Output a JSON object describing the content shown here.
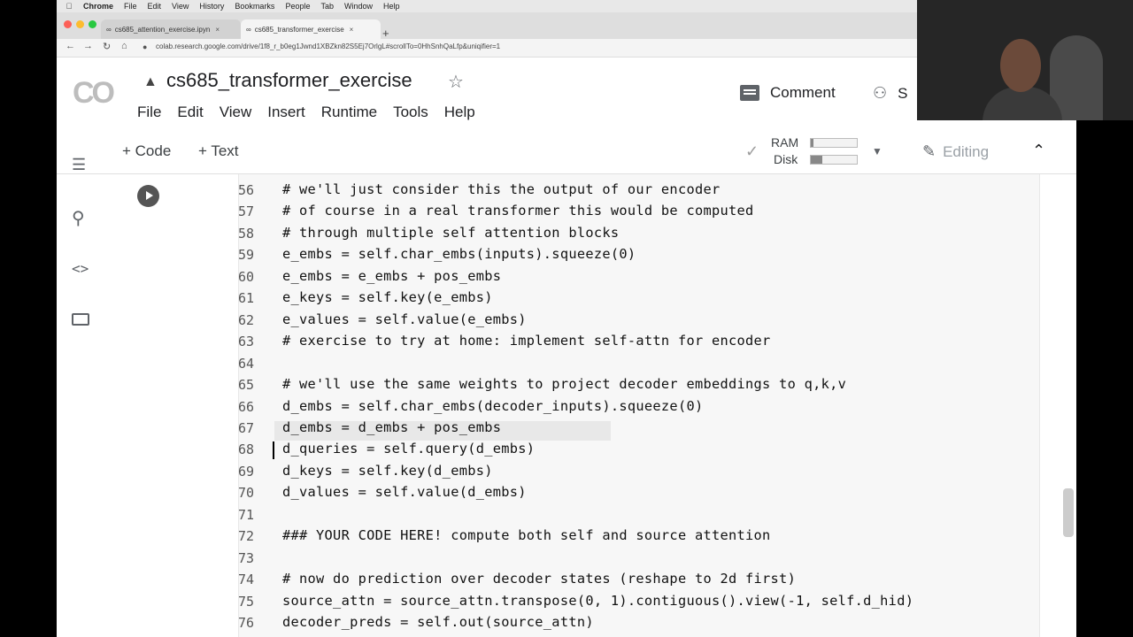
{
  "mac_menu": {
    "app": "Chrome",
    "items": [
      "File",
      "Edit",
      "View",
      "History",
      "Bookmarks",
      "People",
      "Tab",
      "Window",
      "Help"
    ]
  },
  "browser": {
    "tabs": [
      {
        "label": "cs685_attention_exercise.ipyn",
        "active": false
      },
      {
        "label": "cs685_transformer_exercise",
        "active": true
      }
    ],
    "url": "colab.research.google.com/drive/1f8_r_b0eg1Jwnd1XBZkn82S5Ej7OrlgL#scrollTo=0HhSnhQaLfp&uniqifier=1"
  },
  "colab": {
    "logo": "CO",
    "title": "cs685_transformer_exercise",
    "menu": [
      "File",
      "Edit",
      "View",
      "Insert",
      "Runtime",
      "Tools",
      "Help"
    ],
    "comment_label": "Comment",
    "share_label": "S",
    "add_code": "+ Code",
    "add_text": "+ Text",
    "ram_label": "RAM",
    "disk_label": "Disk",
    "ram_usage": 0.05,
    "disk_usage": 0.25,
    "editing_label": "Editing"
  },
  "code_lines": [
    {
      "n": "56",
      "text": "# we'll just consider this the output of our encoder"
    },
    {
      "n": "57",
      "text": "# of course in a real transformer this would be computed"
    },
    {
      "n": "58",
      "text": "# through multiple self attention blocks"
    },
    {
      "n": "59",
      "text": "e_embs = self.char_embs(inputs).squeeze(0)"
    },
    {
      "n": "60",
      "text": "e_embs = e_embs + pos_embs"
    },
    {
      "n": "61",
      "text": "e_keys = self.key(e_embs)"
    },
    {
      "n": "62",
      "text": "e_values = self.value(e_embs)"
    },
    {
      "n": "63",
      "text": "# exercise to try at home: implement self-attn for encoder"
    },
    {
      "n": "64",
      "text": ""
    },
    {
      "n": "65",
      "text": "# we'll use the same weights to project decoder embeddings to q,k,v"
    },
    {
      "n": "66",
      "text": "d_embs = self.char_embs(decoder_inputs).squeeze(0)"
    },
    {
      "n": "67",
      "text": "d_embs = d_embs + pos_embs"
    },
    {
      "n": "68",
      "text": "d_queries = self.query(d_embs)"
    },
    {
      "n": "69",
      "text": "d_keys = self.key(d_embs)"
    },
    {
      "n": "70",
      "text": "d_values = self.value(d_embs)"
    },
    {
      "n": "71",
      "text": ""
    },
    {
      "n": "72",
      "text": "### YOUR CODE HERE! compute both self and source attention"
    },
    {
      "n": "73",
      "text": ""
    },
    {
      "n": "74",
      "text": "# now do prediction over decoder states (reshape to 2d first)"
    },
    {
      "n": "75",
      "text": "source_attn = source_attn.transpose(0, 1).contiguous().view(-1, self.d_hid)"
    },
    {
      "n": "76",
      "text": "decoder_preds = self.out(source_attn)"
    }
  ]
}
